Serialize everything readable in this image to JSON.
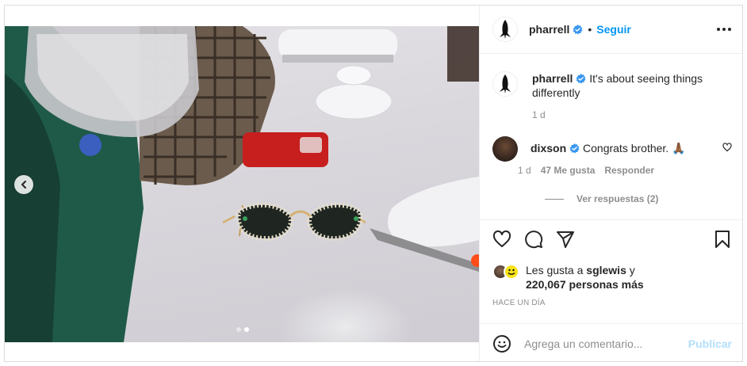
{
  "header": {
    "username": "pharrell",
    "separator": "•",
    "follow_label": "Seguir",
    "more_icon": "more-horizontal-icon"
  },
  "caption": {
    "username": "pharrell",
    "text": " It's about seeing things differently",
    "time": "1 d"
  },
  "comment": {
    "username": "dixson",
    "text": " Congrats brother. 🙏🏾",
    "time": "1 d",
    "likes": "47 Me gusta",
    "reply_label": "Responder",
    "view_replies": "Ver respuestas (2)"
  },
  "likes": {
    "prefix": "Les gusta a ",
    "user": "sglewis",
    "joiner": " y",
    "count": "220,067 personas más"
  },
  "timestamp": "HACE UN DÍA",
  "composer": {
    "placeholder": "Agrega un comentario...",
    "publish_label": "Publicar"
  },
  "carousel": {
    "slides": 2,
    "active_index": 1
  },
  "colors": {
    "accent": "#0095f6",
    "publish_disabled": "#b2dffc",
    "verified": "#3897f0"
  }
}
